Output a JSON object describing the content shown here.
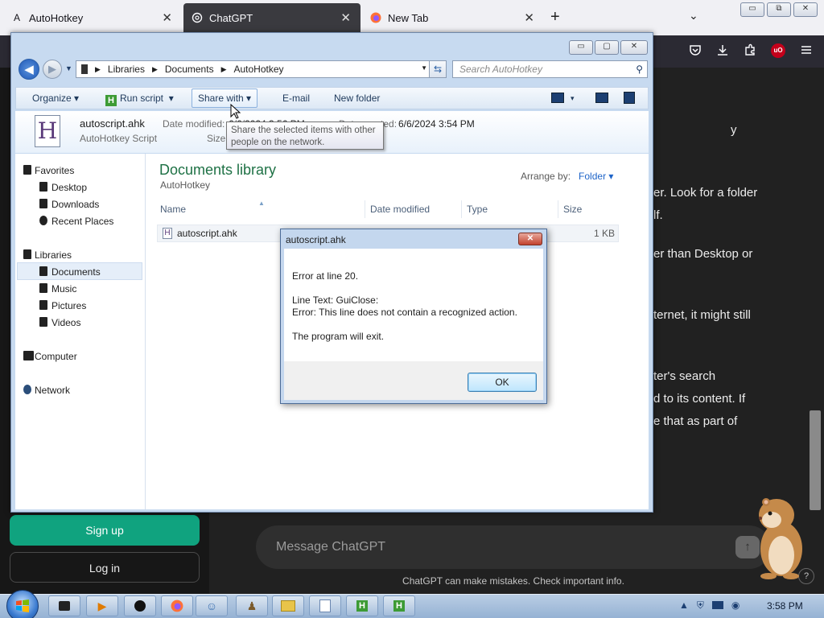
{
  "browser": {
    "tabs": [
      {
        "label": "AutoHotkey",
        "icon": "A"
      },
      {
        "label": "ChatGPT",
        "icon": "chatgpt-logo"
      },
      {
        "label": "New Tab",
        "icon": "firefox-logo"
      }
    ],
    "new_tab_glyph": "+",
    "ublock_label": "uO"
  },
  "chat": {
    "partial_lines": [
      "y",
      "er. Look for a folder",
      "lf.",
      "er than Desktop or",
      "ternet, it might still",
      "ter's search",
      "d to its content. If",
      "e that as part of"
    ],
    "signup_label": "Sign up",
    "login_label": "Log in",
    "message_placeholder": "Message ChatGPT",
    "disclaimer": "ChatGPT can make mistakes. Check important info.",
    "help_glyph": "?"
  },
  "explorer": {
    "breadcrumb": [
      "Libraries",
      "Documents",
      "AutoHotkey"
    ],
    "search_placeholder": "Search AutoHotkey",
    "commands": {
      "organize": "Organize",
      "run_script": "Run script",
      "share_with": "Share with",
      "email": "E-mail",
      "new_folder": "New folder"
    },
    "details": {
      "filename": "autoscript.ahk",
      "filetype": "AutoHotkey Script",
      "date_modified_label": "Date modified:",
      "date_modified_value": "6/6/2024 3:56 PM",
      "date_created_label": "Date created:",
      "date_created_value": "6/6/2024 3:54 PM",
      "size_label": "Size:"
    },
    "tooltip": "Share the selected items with other people on the network.",
    "nav": {
      "favorites": "Favorites",
      "desktop": "Desktop",
      "downloads": "Downloads",
      "recent": "Recent Places",
      "libraries": "Libraries",
      "documents": "Documents",
      "music": "Music",
      "pictures": "Pictures",
      "videos": "Videos",
      "computer": "Computer",
      "network": "Network"
    },
    "library": {
      "title": "Documents library",
      "subtitle": "AutoHotkey",
      "arrange_label": "Arrange by:",
      "arrange_value": "Folder"
    },
    "columns": [
      "Name",
      "Date modified",
      "Type",
      "Size"
    ],
    "files": [
      {
        "name": "autoscript.ahk",
        "size": "1 KB"
      }
    ]
  },
  "dialog": {
    "title": "autoscript.ahk",
    "line1": "Error at line 20.",
    "line2": "Line Text: GuiClose:",
    "line3": "Error: This line does not contain a recognized action.",
    "line4": "The program will exit.",
    "ok_label": "OK"
  },
  "taskbar": {
    "clock": "3:58 PM"
  }
}
